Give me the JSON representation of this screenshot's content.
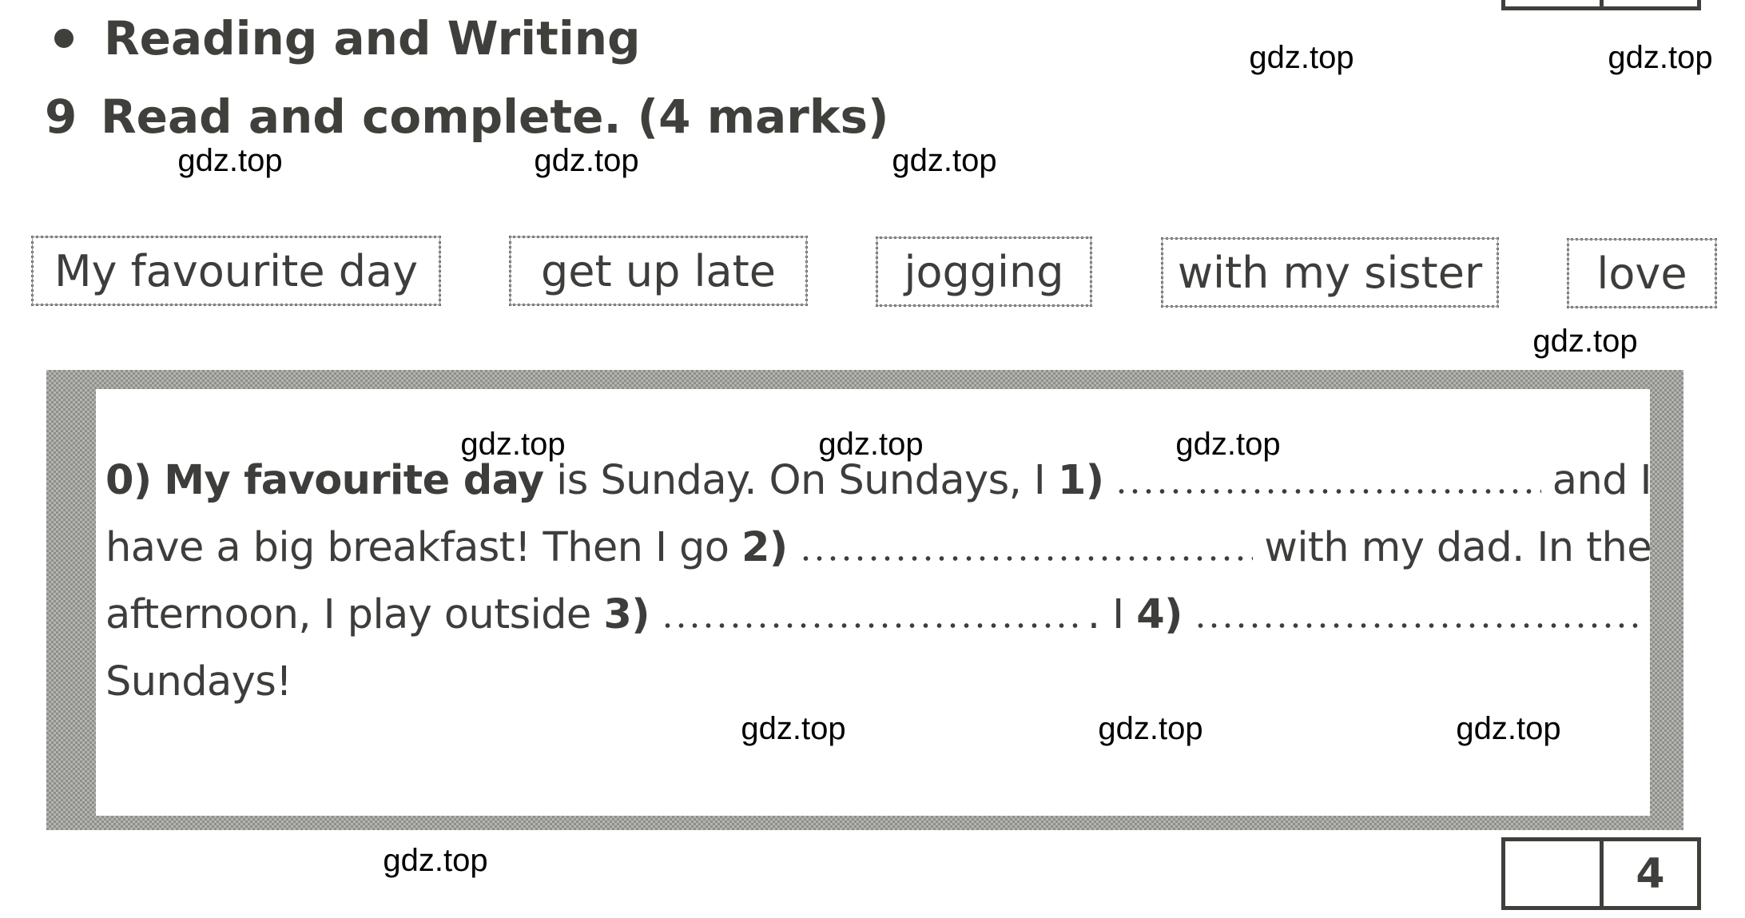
{
  "section": {
    "title": "Reading and Writing",
    "bullet_icon": "filled-circle"
  },
  "task": {
    "number": "9",
    "instruction": "Read and complete. (4 marks)"
  },
  "word_bank": [
    "My favourite day",
    "get up late",
    "jogging",
    "with my sister",
    "love"
  ],
  "passage": {
    "line1": {
      "label0": "0)",
      "answer0": "My favourite day",
      "text_a": "is Sunday. On Sundays, I",
      "label1": "1)",
      "text_b": "and I"
    },
    "line2": {
      "text_a": "have a big breakfast! Then I go",
      "label2": "2)",
      "text_b": "with my dad. In the"
    },
    "line3": {
      "text_a": "afternoon, I play outside",
      "label3": "3)",
      "text_b": ". I",
      "label4": "4)"
    },
    "line4": {
      "text_a": "Sundays!"
    }
  },
  "score_box_top": {
    "earned": "",
    "total": ""
  },
  "score_box_bottom": {
    "earned": "",
    "total": "4"
  },
  "watermarks": {
    "text": "gdz.top"
  },
  "colors": {
    "ink": "#3d3d3b",
    "frame_halftone": "#a3a49f",
    "watermark": "#000000"
  }
}
